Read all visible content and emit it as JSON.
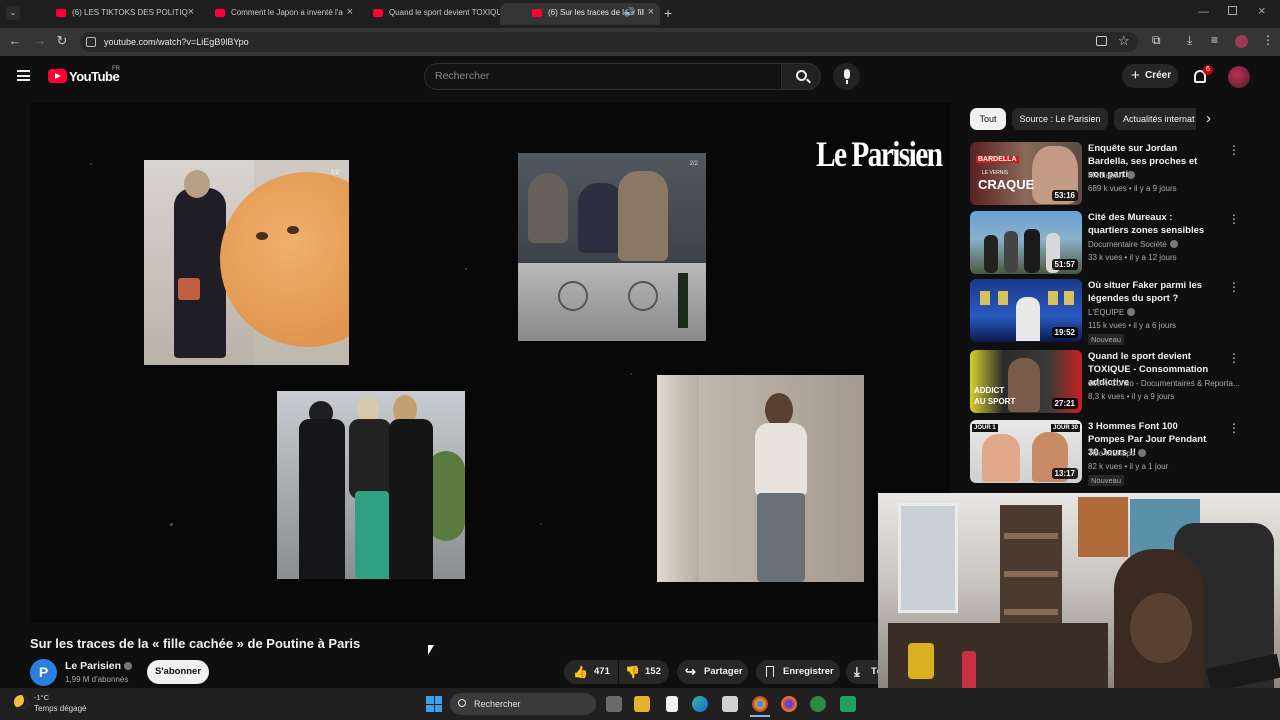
{
  "browser": {
    "tabs": [
      {
        "title": "(6) LES TIKTOKS DES POLITIQUE",
        "active": false
      },
      {
        "title": "Comment le Japon a inventé l'a",
        "active": false
      },
      {
        "title": "Quand le sport devient TOXIQU",
        "active": false
      },
      {
        "title": "(6) Sur les traces de la « fille",
        "active": true
      }
    ],
    "url": "youtube.com/watch?v=LiEgB9lBYpo"
  },
  "youtube": {
    "logo": "YouTube",
    "country": "FR",
    "search_placeholder": "Rechercher",
    "create_label": "Créer",
    "notifications_count": "6"
  },
  "player": {
    "watermark": "Le Parisien",
    "counter_a": "1/2",
    "counter_b": "2/2"
  },
  "video": {
    "title": "Sur les traces de la « fille cachée » de Poutine à Paris",
    "channel": "Le Parisien",
    "subscribers": "1,99 M d'abonnés",
    "subscribe_label": "S'abonner",
    "likes": "471",
    "dislikes": "152",
    "share_label": "Partager",
    "save_label": "Enregistrer",
    "more_label": "Té"
  },
  "chips": [
    "Tout",
    "Source : Le Parisien",
    "Actualités internat"
  ],
  "recommendations": [
    {
      "title": "Enquête sur Jordan Bardella, ses proches et son parti",
      "channel": "Mediapart",
      "verified": true,
      "views": "689 k vues",
      "age": "il y a 9 jours",
      "duration": "53:16",
      "badge": "",
      "thumb_text_top": "BARDELLA",
      "thumb_text_mid": "LE VERNIS",
      "thumb_text_bot": "CRAQUE"
    },
    {
      "title": "Cité des Mureaux : quartiers zones sensibles",
      "channel": "Documentaire Société",
      "verified": true,
      "views": "33 k vues",
      "age": "il y a 12 jours",
      "duration": "51:57",
      "badge": ""
    },
    {
      "title": "Où situer Faker parmi les légendes du sport ?",
      "channel": "L'ÉQUIPE",
      "verified": true,
      "views": "115 k vues",
      "age": "il y a 6 jours",
      "duration": "19:52",
      "badge": "Nouveau"
    },
    {
      "title": "Quand le sport devient TOXIQUE - Consommation addictive",
      "channel": "100% Conso - Documentaires & Reporta...",
      "verified": false,
      "views": "8,3 k vues",
      "age": "il y a 9 jours",
      "duration": "27:21",
      "badge": "",
      "thumb_text_top": "ADDICT",
      "thumb_text_mid": "AU SPORT"
    },
    {
      "title": "3 Hommes Font 100 Pompes Par Jour Pendant 30 Jours !!",
      "channel": "Tibo InShape",
      "verified": true,
      "views": "82 k vues",
      "age": "il y a 1 jour",
      "duration": "13:17",
      "badge": "Nouveau",
      "thumb_text_top": "JOUR 1",
      "thumb_text_mid": "JOUR 30"
    }
  ],
  "weather": {
    "temp": "-1°C",
    "desc": "Temps dégagé"
  },
  "taskbar": {
    "search_placeholder": "Rechercher"
  },
  "colors": {
    "brand_red": "#ff0033",
    "bg": "#0f0f0f",
    "accent_blue": "#2b7fde"
  },
  "icons": [
    "youtube-logo-icon",
    "menu-icon",
    "search-icon",
    "mic-icon",
    "plus-icon",
    "bell-icon",
    "like-icon",
    "dislike-icon",
    "share-icon",
    "bookmark-icon",
    "download-icon",
    "windows-icon",
    "chevron-right-icon"
  ]
}
